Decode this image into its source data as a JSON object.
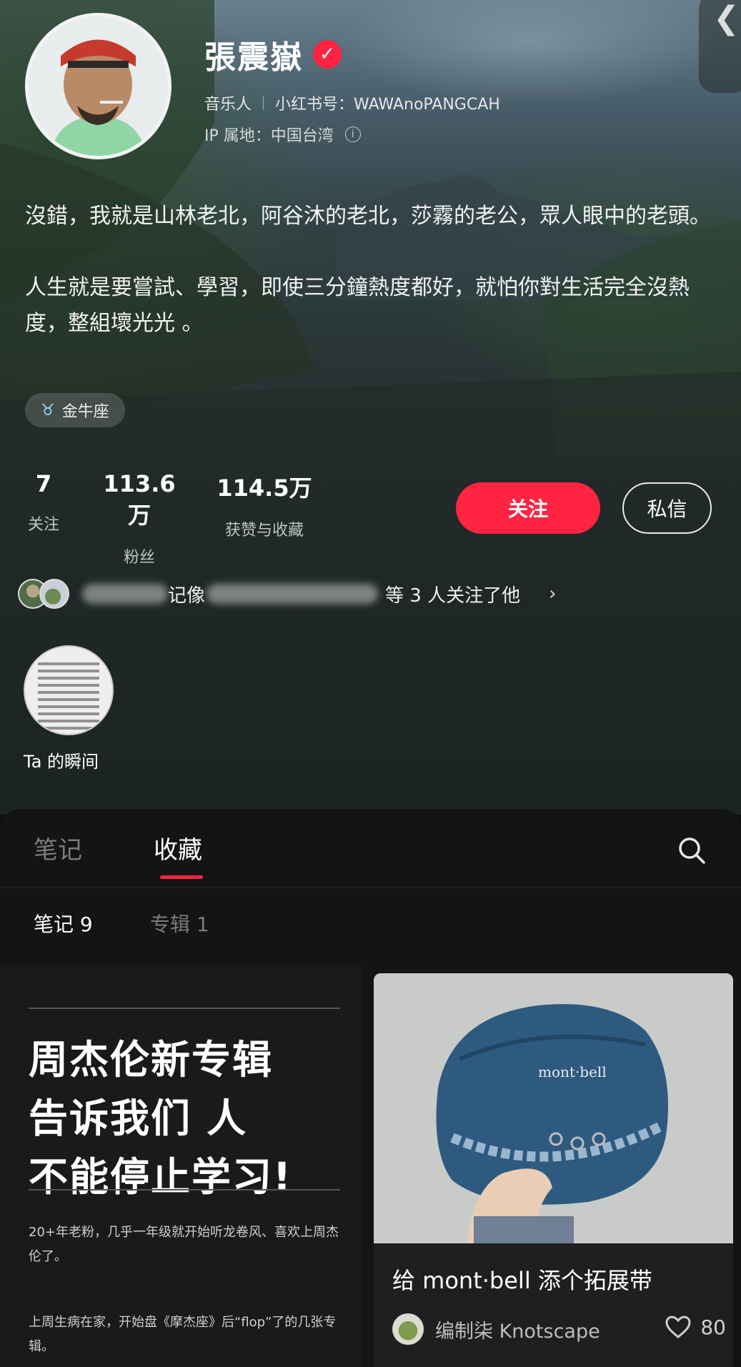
{
  "profile": {
    "name": "張震嶽",
    "role": "音乐人",
    "rednote_id": "小红书号：WAWAnoPANGCAH",
    "ip_location": "IP 属地：中国台湾",
    "bio_paragraph_1": "沒錯，我就是山林老北，阿谷沐的老北，莎霧的老公，眾人眼中的老頭。",
    "bio_paragraph_2": "人生就是要嘗試、學習，即使三分鐘熱度都好，就怕你對生活完全沒熱度，整組壞光光 。",
    "zodiac_tag": "金牛座"
  },
  "stats": [
    {
      "value": "7",
      "label": "关注"
    },
    {
      "value": "113.6万",
      "label": "粉丝"
    },
    {
      "value": "114.5万",
      "label": "获赞与收藏"
    }
  ],
  "actions": {
    "follow_label": "关注",
    "message_label": "私信"
  },
  "mutual": {
    "visible_fragment": "记像",
    "suffix": "等 3 人关注了他"
  },
  "moments": {
    "label": "Ta 的瞬间"
  },
  "tabs": {
    "notes": "笔记",
    "favorites": "收藏",
    "active": "收藏"
  },
  "subtabs": {
    "notes": "笔记 9",
    "albums": "专辑 1",
    "active": "笔记 9"
  },
  "cards": [
    {
      "headline_lines": [
        "周杰伦新专辑",
        "告诉我们 人",
        "不能停止学习!"
      ],
      "text_1": "20+年老粉，几乎一年级就开始听龙卷风、喜欢上周杰伦了。",
      "text_2": "上周生病在家，开始盘《摩杰座》后“flop”了的几张专辑。"
    },
    {
      "title": "给 mont·bell 添个拓展带",
      "author": "编制柒 Knotscape",
      "likes": "80",
      "photo_brand": "mont·bell"
    }
  ],
  "colors": {
    "accent": "#ff2442",
    "panel_bg": "#141414"
  }
}
